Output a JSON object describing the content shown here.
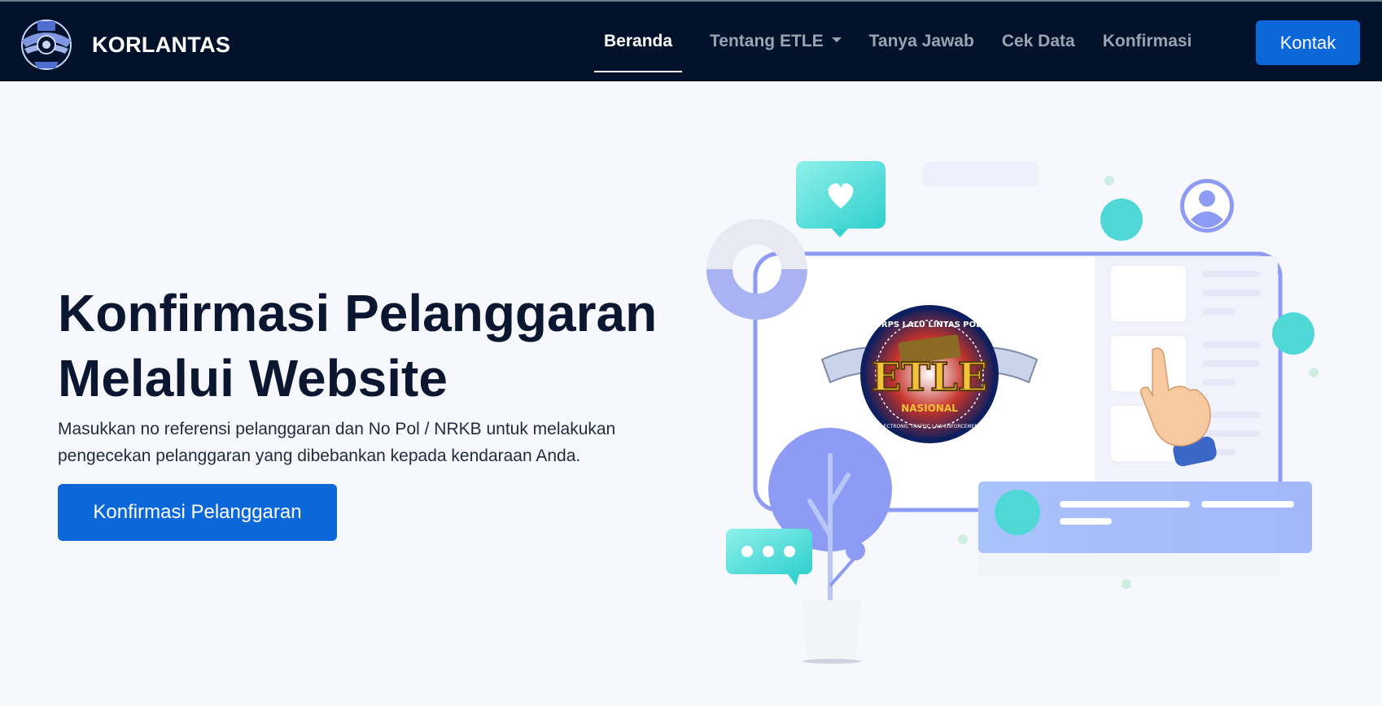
{
  "navbar": {
    "brand": "KORLANTAS",
    "links": [
      {
        "label": "Beranda"
      },
      {
        "label": "Tentang ETLE"
      },
      {
        "label": "Tanya Jawab"
      },
      {
        "label": "Cek Data"
      },
      {
        "label": "Konfirmasi"
      }
    ],
    "contact_label": "Kontak"
  },
  "hero": {
    "title_line1": "Konfirmasi Pelanggaran",
    "title_line2": "Melalui Website",
    "description": "Masukkan no referensi pelanggaran dan No Pol / NRKB untuk melakukan pengecekan pelanggaran yang dibebankan kepada kendaraan Anda.",
    "cta_label": "Konfirmasi Pelanggaran"
  },
  "etle_badge": {
    "top_text": "KORPS LALU LINTAS POLRI",
    "main_text": "ETLE",
    "sub_text": "NASIONAL",
    "bottom_text": "ELECTRONIC TRAFFIC LAW ENFORCEMENT"
  },
  "colors": {
    "navbar_bg": "#02122b",
    "primary": "#0c67d9",
    "page_bg": "#f7f8fd",
    "teal": "#4fd8d6",
    "periwinkle": "#8e9bf5"
  }
}
